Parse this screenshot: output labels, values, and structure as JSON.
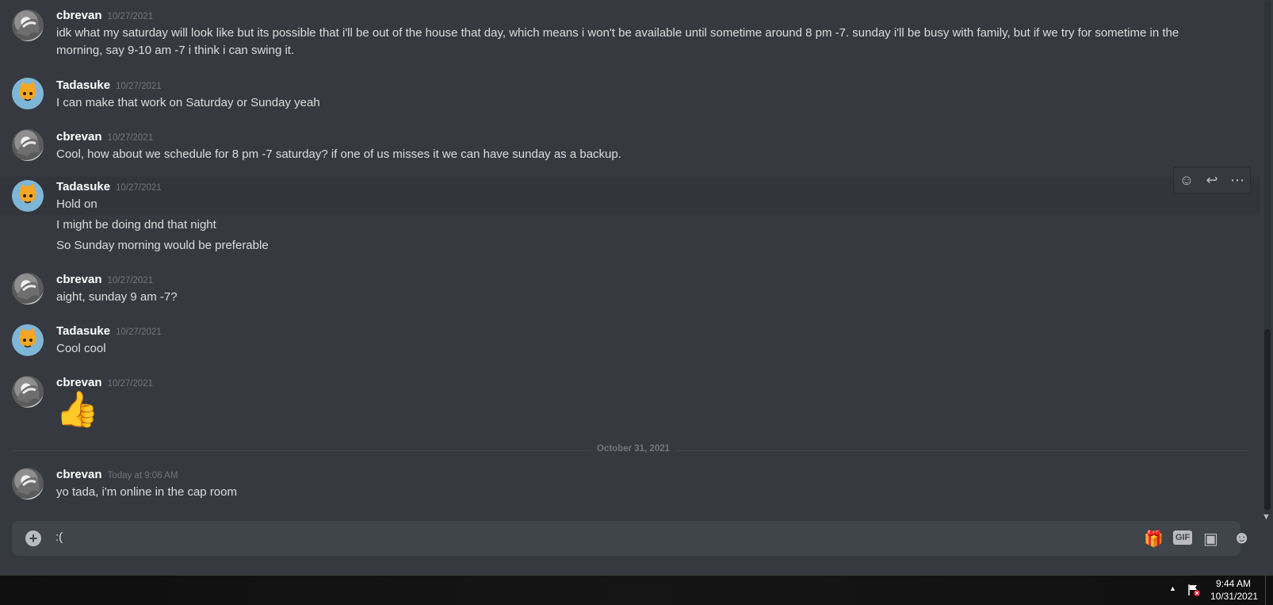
{
  "messages": [
    {
      "author": "cbrevan",
      "timestamp": "10/27/2021",
      "lines": [
        "idk what my saturday will look like but its possible that i'll be out of the house that day, which means i won't be available until sometime around 8 pm -7. sunday i'll be busy with family, but if we try for sometime in the",
        "morning, say 9-10 am -7 i think i can swing it."
      ]
    },
    {
      "author": "Tadasuke",
      "timestamp": "10/27/2021",
      "lines": [
        "I can make that work on Saturday or Sunday yeah"
      ]
    },
    {
      "author": "cbrevan",
      "timestamp": "10/27/2021",
      "lines": [
        "Cool, how about we schedule for 8 pm -7 saturday? if one of us misses it we can have sunday as a backup."
      ]
    },
    {
      "author": "Tadasuke",
      "timestamp": "10/27/2021",
      "lines": [
        "Hold on"
      ]
    },
    {
      "author": "",
      "timestamp": "",
      "lines": [
        "I might be doing dnd that night"
      ]
    },
    {
      "author": "",
      "timestamp": "",
      "lines": [
        "So Sunday morning would be preferable"
      ]
    },
    {
      "author": "cbrevan",
      "timestamp": "10/27/2021",
      "lines": [
        "aight, sunday 9 am -7?"
      ]
    },
    {
      "author": "Tadasuke",
      "timestamp": "10/27/2021",
      "lines": [
        "Cool cool"
      ]
    },
    {
      "author": "cbrevan",
      "timestamp": "10/27/2021",
      "emoji": "👍"
    },
    {
      "author": "cbrevan",
      "timestamp": "Today at 9:06 AM",
      "lines": [
        "yo tada, i'm online in the cap room"
      ]
    }
  ],
  "date_divider": "October 31, 2021",
  "message_toolbar": {
    "icons": [
      "add-reaction-icon",
      "reply-icon",
      "more-options-icon"
    ],
    "glyphs": {
      "reaction": "☺",
      "reply": "↩",
      "more": "⋯"
    }
  },
  "composer": {
    "value": ":(",
    "plus_glyph": "+",
    "gift_glyph": "🎁",
    "gif_label": "GIF",
    "sticker_glyph": "▣",
    "emoji_glyph": "☻"
  },
  "taskbar": {
    "time": "9:44 AM",
    "date": "10/31/2021",
    "tray_up_glyph": "▲"
  },
  "scrollbar": {
    "arrow_glyph": "▼"
  },
  "colors": {
    "background": "#36393f",
    "composer": "#40444b",
    "username": "#ffffff",
    "timestamp": "#72767d",
    "text": "#dcddde"
  }
}
